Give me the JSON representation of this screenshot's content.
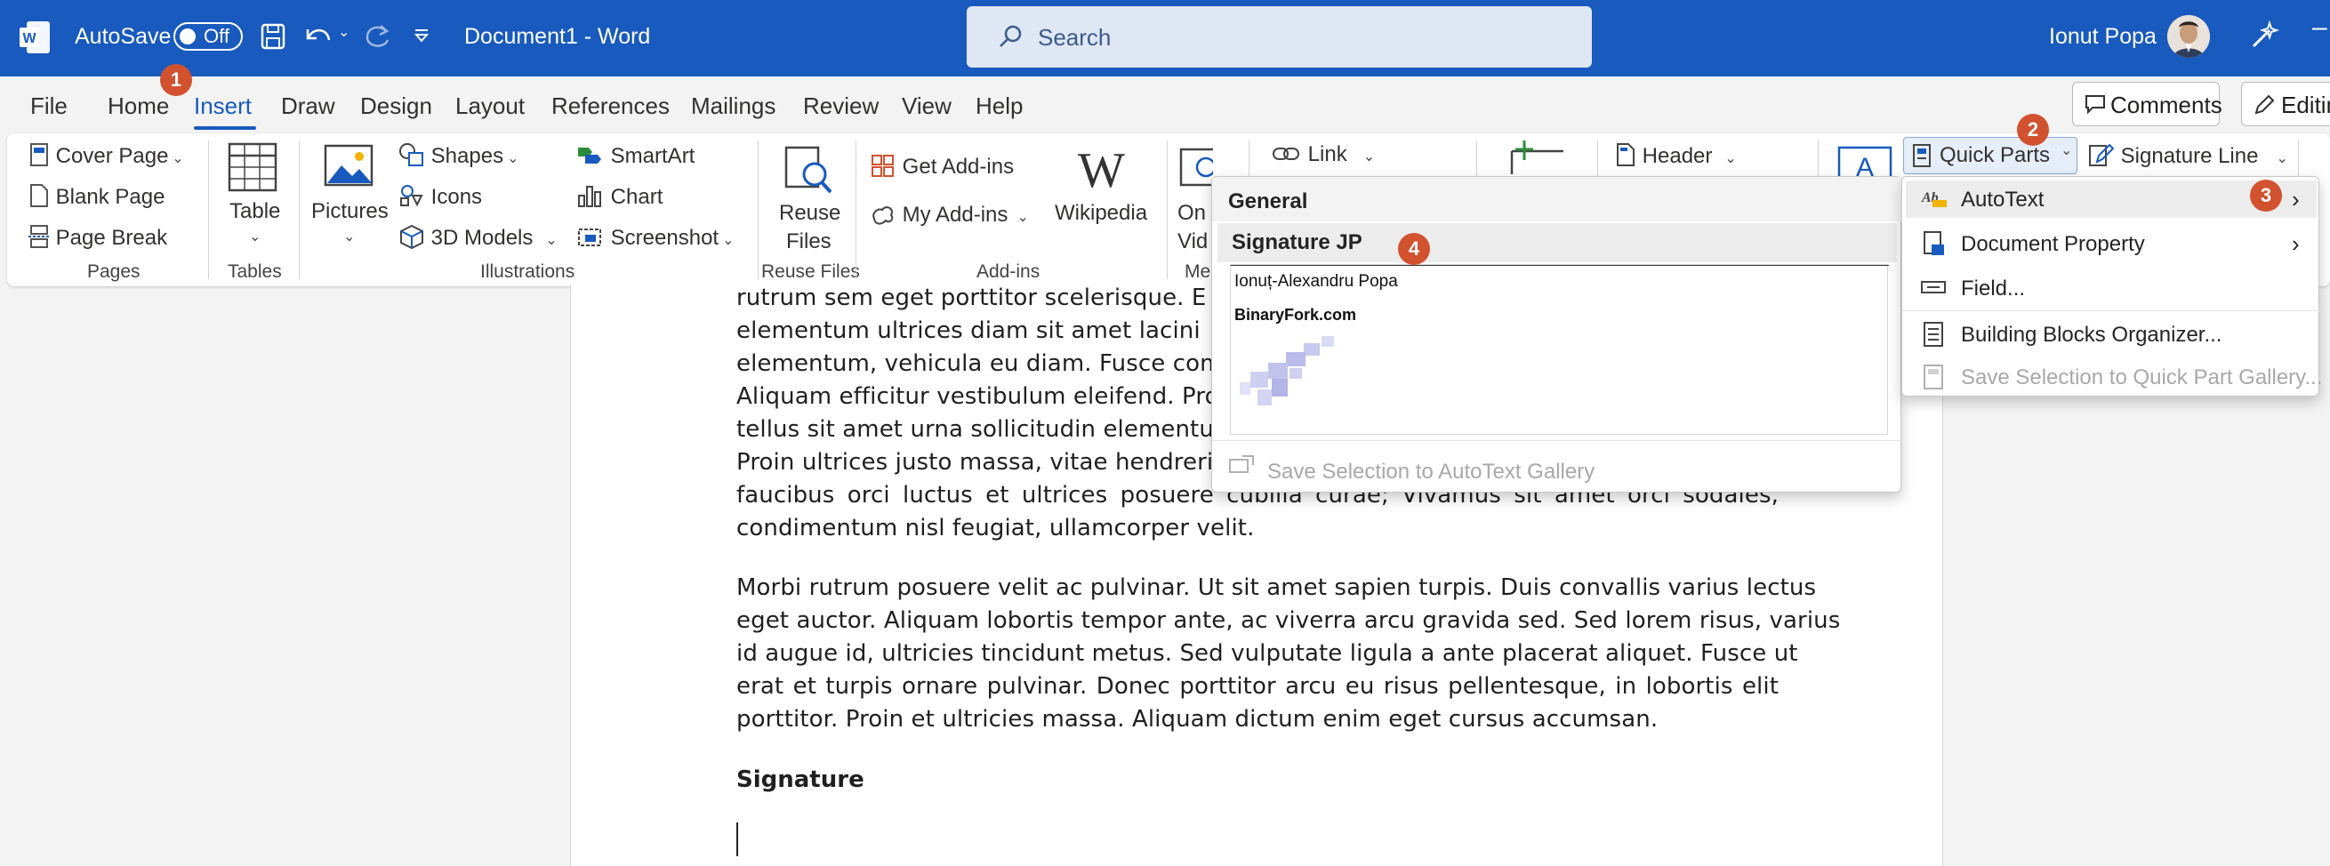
{
  "titlebar": {
    "autosave_label": "AutoSave",
    "autosave_state": "Off",
    "document_title": "Document1  -  Word",
    "search_placeholder": "Search",
    "user_name": "Ionut Popa"
  },
  "menu": {
    "tabs": [
      "File",
      "Home",
      "Insert",
      "Draw",
      "Design",
      "Layout",
      "References",
      "Mailings",
      "Review",
      "View",
      "Help"
    ],
    "active_tab": "Insert",
    "comments_label": "Comments",
    "editing_label": "Editin"
  },
  "ribbon": {
    "pages": {
      "cover_page": "Cover Page",
      "blank_page": "Blank Page",
      "page_break": "Page Break",
      "group": "Pages"
    },
    "tables": {
      "table": "Table",
      "group": "Tables"
    },
    "illustrations": {
      "pictures": "Pictures",
      "shapes": "Shapes",
      "icons": "Icons",
      "models": "3D Models",
      "smartart": "SmartArt",
      "chart": "Chart",
      "screenshot": "Screenshot",
      "group": "Illustrations"
    },
    "reuse": {
      "reuse_line1": "Reuse",
      "reuse_line2": "Files",
      "group": "Reuse Files"
    },
    "addins": {
      "get_addins": "Get Add-ins",
      "my_addins": "My Add-ins",
      "wikipedia": "Wikipedia",
      "group": "Add-ins"
    },
    "media": {
      "online_line1": "On",
      "online_line2": "Vid",
      "group": "Me"
    },
    "link": "Link",
    "header": "Header",
    "quick_parts": "Quick Parts",
    "signature_line": "Signature Line"
  },
  "autotext_gallery": {
    "section_general": "General",
    "entry_name": "Signature JP",
    "preview_name": "Ionuț-Alexandru  Popa",
    "preview_site": "BinaryFork.com",
    "save_selection": "Save Selection to AutoText Gallery"
  },
  "quickparts_menu": {
    "autotext": "AutoText",
    "document_property": "Document Property",
    "field": "Field...",
    "building_blocks": "Building Blocks Organizer...",
    "save_selection": "Save Selection to Quick Part Gallery..."
  },
  "badges": [
    "1",
    "2",
    "3",
    "4"
  ],
  "document": {
    "lines": [
      "rutrum sem eget porttitor scelerisque. E",
      "elementum ultrices diam sit amet lacini",
      "elementum, vehicula eu diam. Fusce comr",
      "Aliquam efficitur vestibulum eleifend. Proi",
      "tellus sit amet urna sollicitudin elementur",
      "Proin ultrices justo massa, vitae hendrerit",
      "faucibus orci luctus et ultrices posuere cubilia curae; Vivamus sit amet orci sodales,",
      "condimentum nisl feugiat, ullamcorper velit."
    ],
    "paragraph2": [
      "Morbi rutrum posuere velit ac pulvinar. Ut sit amet sapien turpis. Duis convallis varius lectus",
      "eget auctor. Aliquam lobortis tempor ante, ac viverra arcu gravida sed. Sed lorem risus, varius",
      "id augue id, ultricies tincidunt metus. Sed vulputate ligula a ante placerat aliquet. Fusce ut",
      "erat et turpis ornare pulvinar. Donec porttitor arcu eu risus pellentesque, in lobortis elit",
      "porttitor. Proin et ultricies massa. Aliquam dictum enim eget cursus accumsan."
    ],
    "heading": "Signature"
  },
  "colors": {
    "title_bar": "#185abd",
    "accent": "#185abd",
    "badge": "#d2512f"
  }
}
